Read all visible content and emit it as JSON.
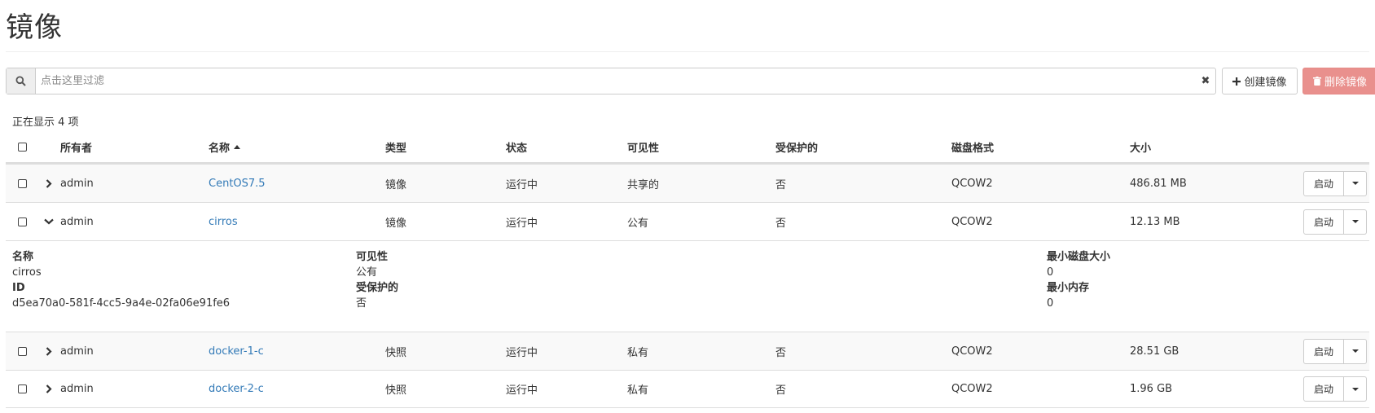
{
  "page": {
    "title": "镜像"
  },
  "toolbar": {
    "search_placeholder": "点击这里过滤",
    "clear_label": "✖",
    "create_label": "创建镜像",
    "delete_label": "删除镜像"
  },
  "count_text": "正在显示 4 项",
  "table": {
    "headers": {
      "owner": "所有者",
      "name": "名称",
      "type": "类型",
      "status": "状态",
      "visibility": "可见性",
      "protected": "受保护的",
      "disk_format": "磁盘格式",
      "size": "大小"
    },
    "rows": [
      {
        "owner": "admin",
        "name": "CentOS7.5",
        "type": "镜像",
        "status": "运行中",
        "visibility": "共享的",
        "protected": "否",
        "disk_format": "QCOW2",
        "size": "486.81 MB",
        "action": "启动",
        "expanded": false
      },
      {
        "owner": "admin",
        "name": "cirros",
        "type": "镜像",
        "status": "运行中",
        "visibility": "公有",
        "protected": "否",
        "disk_format": "QCOW2",
        "size": "12.13 MB",
        "action": "启动",
        "expanded": true
      },
      {
        "owner": "admin",
        "name": "docker-1-c",
        "type": "快照",
        "status": "运行中",
        "visibility": "私有",
        "protected": "否",
        "disk_format": "QCOW2",
        "size": "28.51 GB",
        "action": "启动",
        "expanded": false
      },
      {
        "owner": "admin",
        "name": "docker-2-c",
        "type": "快照",
        "status": "运行中",
        "visibility": "私有",
        "protected": "否",
        "disk_format": "QCOW2",
        "size": "1.96 GB",
        "action": "启动",
        "expanded": false
      }
    ],
    "detail": {
      "name_label": "名称",
      "name_value": "cirros",
      "id_label": "ID",
      "id_value": "d5ea70a0-581f-4cc5-9a4e-02fa06e91fe6",
      "visibility_label": "可见性",
      "visibility_value": "公有",
      "protected_label": "受保护的",
      "protected_value": "否",
      "min_disk_label": "最小磁盘大小",
      "min_disk_value": "0",
      "min_ram_label": "最小内存",
      "min_ram_value": "0"
    }
  },
  "colors": {
    "link": "#337ab7",
    "delete_button": "#e9908d",
    "stripe": "#f9f9f9",
    "border": "#dddddd"
  },
  "icons": {
    "search": "search-icon",
    "clear": "close-icon",
    "create": "plus-icon",
    "delete": "trash-icon",
    "expand": "chevron-right-icon",
    "collapse": "chevron-down-icon",
    "sort": "sort-up-icon",
    "dropdown": "caret-down-icon"
  }
}
